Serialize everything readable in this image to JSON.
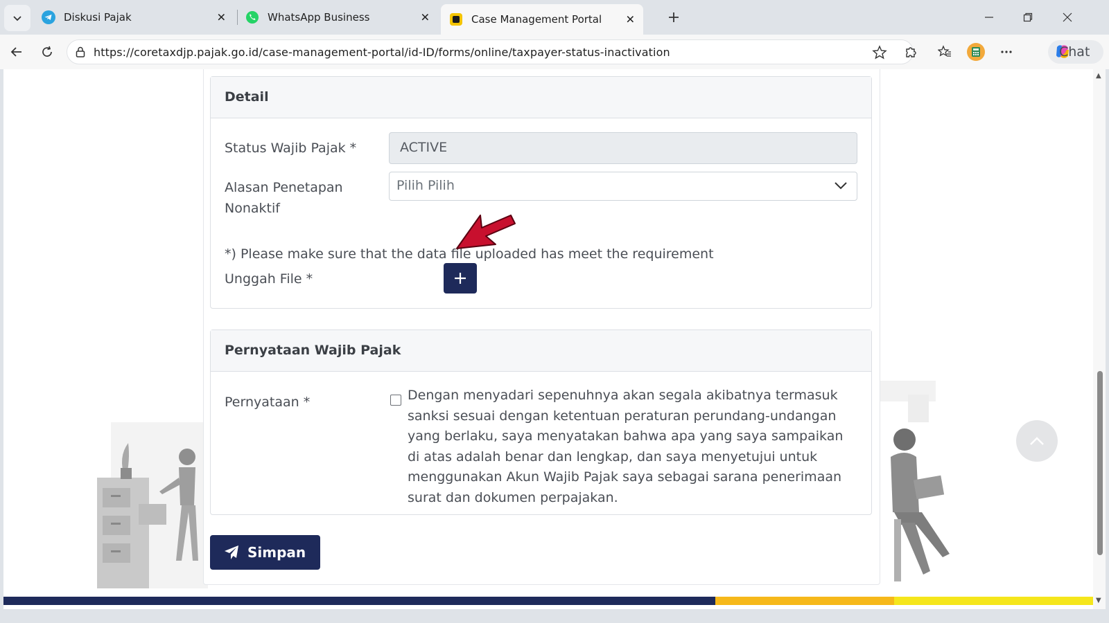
{
  "browser": {
    "tabs": [
      {
        "title": "Diskusi Pajak",
        "icon": "telegram-icon",
        "active": false
      },
      {
        "title": "WhatsApp Business",
        "icon": "whatsapp-icon",
        "active": false
      },
      {
        "title": "Case Management Portal",
        "icon": "portal-icon",
        "active": true
      }
    ],
    "url": "https://coretaxdjp.pajak.go.id/case-management-portal/id-ID/forms/online/taxpayer-status-inactivation",
    "chat_label": "Chat"
  },
  "form": {
    "detail": {
      "heading": "Detail",
      "status_label": "Status Wajib Pajak *",
      "status_value": "ACTIVE",
      "reason_label_line1": "Alasan Penetapan",
      "reason_label_line2": "Nonaktif",
      "reason_placeholder": "Pilih Pilih",
      "note": "*) Please make sure that the data file uploaded has meet the requirement",
      "upload_label": "Unggah File *"
    },
    "statement": {
      "heading": "Pernyataan Wajib Pajak",
      "label": "Pernyataan *",
      "text": "Dengan menyadari sepenuhnya akan segala akibatnya termasuk sanksi sesuai dengan ketentuan peraturan perundang-undangan yang berlaku, saya menyatakan bahwa apa yang saya sampaikan di atas adalah benar dan lengkap, dan saya menyetujui untuk menggunakan Akun Wajib Pajak saya sebagai sarana penerimaan surat dan dokumen perpajakan.",
      "checked": false
    },
    "save_label": "Simpan"
  },
  "colors": {
    "primary": "#1e2a5a",
    "footer_navy": "#1e2a5a",
    "footer_orange": "#f6b81a",
    "footer_yellow": "#f5e61c",
    "annotation_arrow": "#c8102e"
  }
}
